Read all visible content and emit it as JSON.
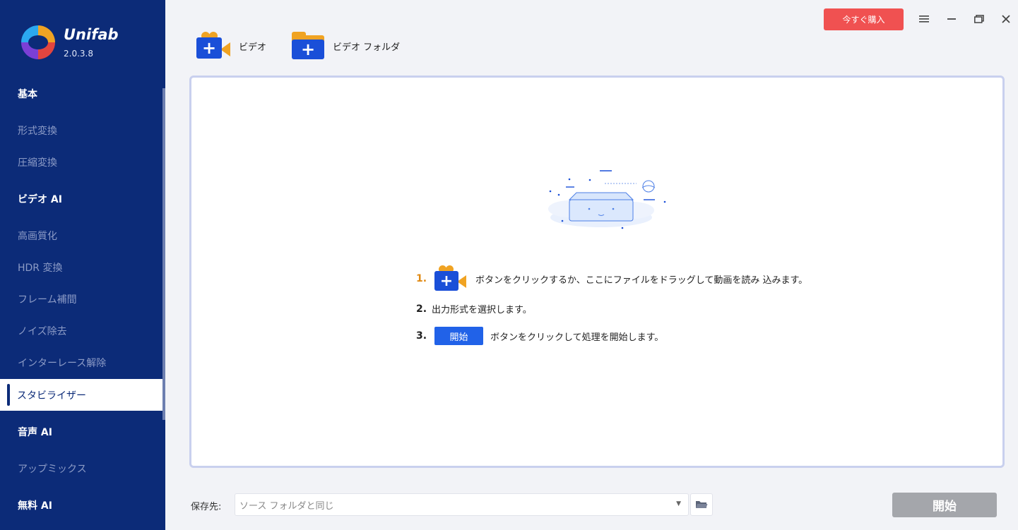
{
  "app": {
    "brand": "Unifab",
    "version": "2.0.3.8"
  },
  "sidebar": {
    "items": [
      {
        "label": "基本",
        "type": "head"
      },
      {
        "label": "形式変換",
        "type": "item"
      },
      {
        "label": "圧縮変換",
        "type": "item"
      },
      {
        "label": "ビデオ AI",
        "type": "head"
      },
      {
        "label": "高画質化",
        "type": "item"
      },
      {
        "label": "HDR 変換",
        "type": "item"
      },
      {
        "label": "フレーム補間",
        "type": "item"
      },
      {
        "label": "ノイズ除去",
        "type": "item"
      },
      {
        "label": "インターレース解除",
        "type": "item"
      },
      {
        "label": "スタビライザー",
        "type": "item",
        "active": true
      },
      {
        "label": "音声 AI",
        "type": "head"
      },
      {
        "label": "アップミックス",
        "type": "item"
      },
      {
        "label": "無料 AI",
        "type": "head"
      }
    ]
  },
  "titlebar": {
    "buy_label": "今すぐ購入",
    "menu_icon": "menu-icon",
    "minimize_icon": "minimize-icon",
    "restore_icon": "restore-icon",
    "close_icon": "close-icon"
  },
  "toolbar": {
    "add_video_label": "ビデオ",
    "add_folder_label": "ビデオ フォルダ"
  },
  "steps": {
    "s1_num": "1.",
    "s1_text": "ボタンをクリックするか、ここにファイルをドラッグして動画を読み 込みます。",
    "s2_num": "2.",
    "s2_text": "出力形式を選択します。",
    "s3_num": "3.",
    "s3_btn": "開始",
    "s3_text": "ボタンをクリックして処理を開始します。"
  },
  "bottom": {
    "save_label": "保存先:",
    "save_value": "ソース フォルダと同じ",
    "start_label": "開始"
  },
  "colors": {
    "sidebar": "#0c2b78",
    "accent": "#2162e8",
    "buy": "#f05151",
    "orange": "#f0a323"
  }
}
